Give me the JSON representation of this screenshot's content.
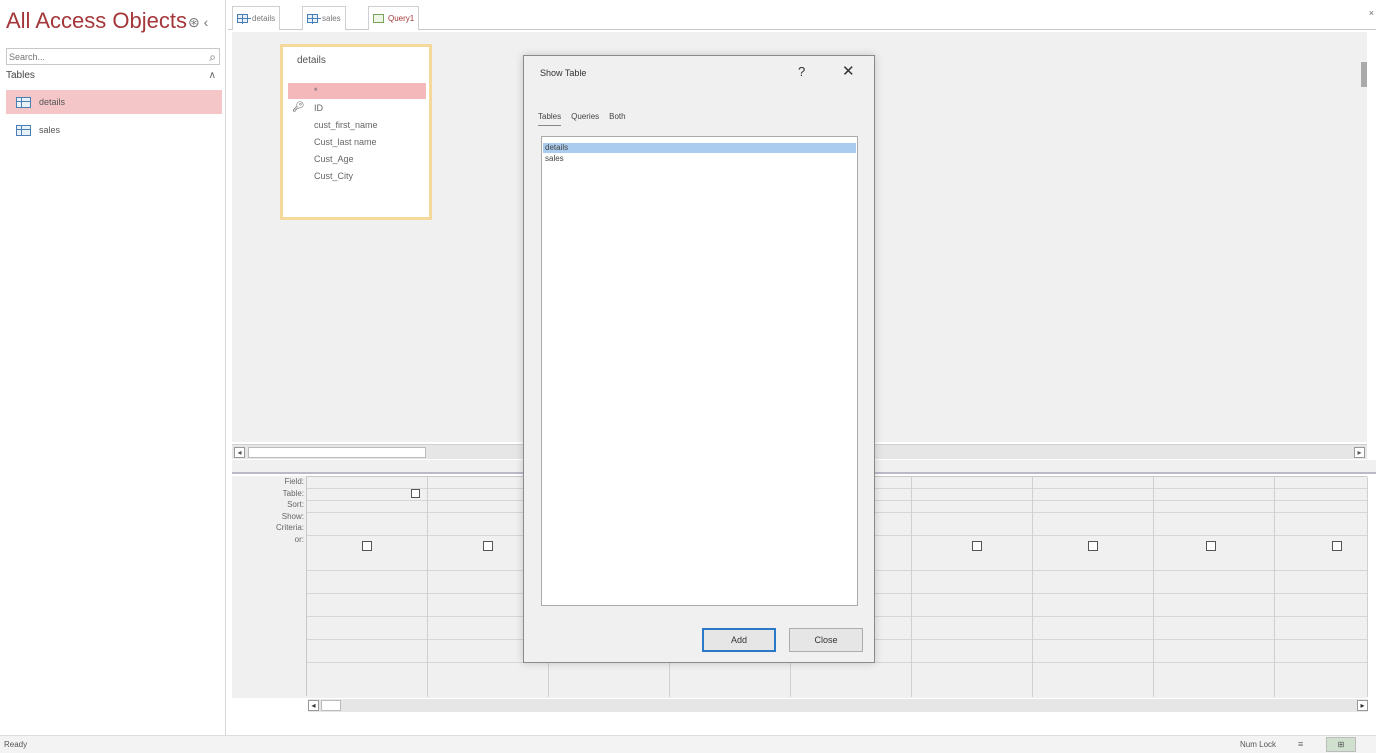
{
  "nav": {
    "title": "All Access Objects",
    "title_icons": "⊛ ‹",
    "search_placeholder": "Search...",
    "group_label": "Tables",
    "group_chevron": "∧",
    "items": [
      {
        "label": "details",
        "selected": true
      },
      {
        "label": "sales",
        "selected": false
      }
    ]
  },
  "tabs": {
    "items": [
      {
        "label": "details",
        "icon": "table-icon"
      },
      {
        "label": "sales",
        "icon": "table-icon"
      },
      {
        "label": "Query1",
        "icon": "query-icon"
      }
    ],
    "close_glyph": "×"
  },
  "field_list": {
    "title": "details",
    "fields": [
      {
        "label": "*",
        "key": false
      },
      {
        "label": "ID",
        "key": true
      },
      {
        "label": "cust_first_name",
        "key": false
      },
      {
        "label": "Cust_last name",
        "key": false
      },
      {
        "label": "Cust_Age",
        "key": false
      },
      {
        "label": "Cust_City",
        "key": false
      }
    ]
  },
  "qbe": {
    "row_labels": [
      "Field:",
      "Table:",
      "Sort:",
      "Show:",
      "Criteria:",
      "or:"
    ]
  },
  "dialog": {
    "title": "Show Table",
    "help": "?",
    "close": "✕",
    "tabs": [
      "Tables",
      "Queries",
      "Both"
    ],
    "list": [
      "details",
      "sales"
    ],
    "add_label": "Add",
    "close_label": "Close"
  },
  "status": {
    "left": "Ready",
    "num_lock": "Num Lock"
  },
  "colors": {
    "accent": "#a4373a",
    "selection": "#f4c6c8",
    "dialog_selection": "#aaccee"
  }
}
